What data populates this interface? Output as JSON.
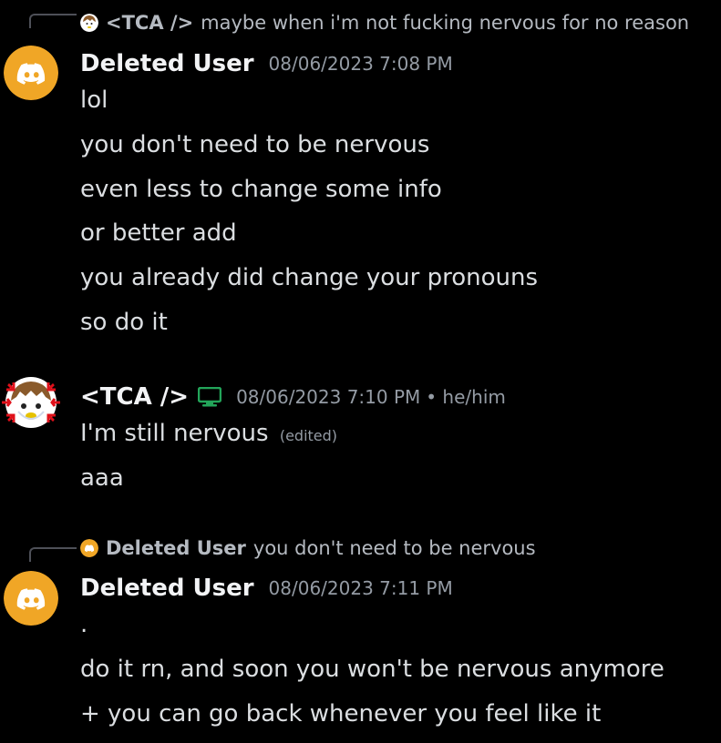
{
  "colors": {
    "background": "#000000",
    "discord_orange": "#f0a626",
    "online_green": "#23a55a",
    "muted": "#949ba4"
  },
  "messages": [
    {
      "reply": {
        "author": "<TCA />",
        "text": "maybe when i'm not fucking nervous for no reason"
      },
      "author": "Deleted User",
      "timestamp": "08/06/2023 7:08 PM",
      "lines": [
        "lol",
        "you don't need to be nervous",
        "even less to change some info",
        "or better add",
        "you already did change your pronouns",
        "so do it"
      ]
    },
    {
      "author": "<TCA />",
      "timestamp": "08/06/2023 7:10 PM",
      "pronouns": "• he/him",
      "device_icon": "desktop-icon",
      "lines": [
        "I'm still nervous",
        "aaa"
      ],
      "edited_label": "(edited)"
    },
    {
      "reply": {
        "author": "Deleted User",
        "text": "you don't need to be nervous"
      },
      "author": "Deleted User",
      "timestamp": "08/06/2023 7:11 PM",
      "lines": [
        ".",
        "do it rn, and soon you won't be nervous anymore",
        "+ you can go back whenever you feel like it"
      ]
    }
  ]
}
